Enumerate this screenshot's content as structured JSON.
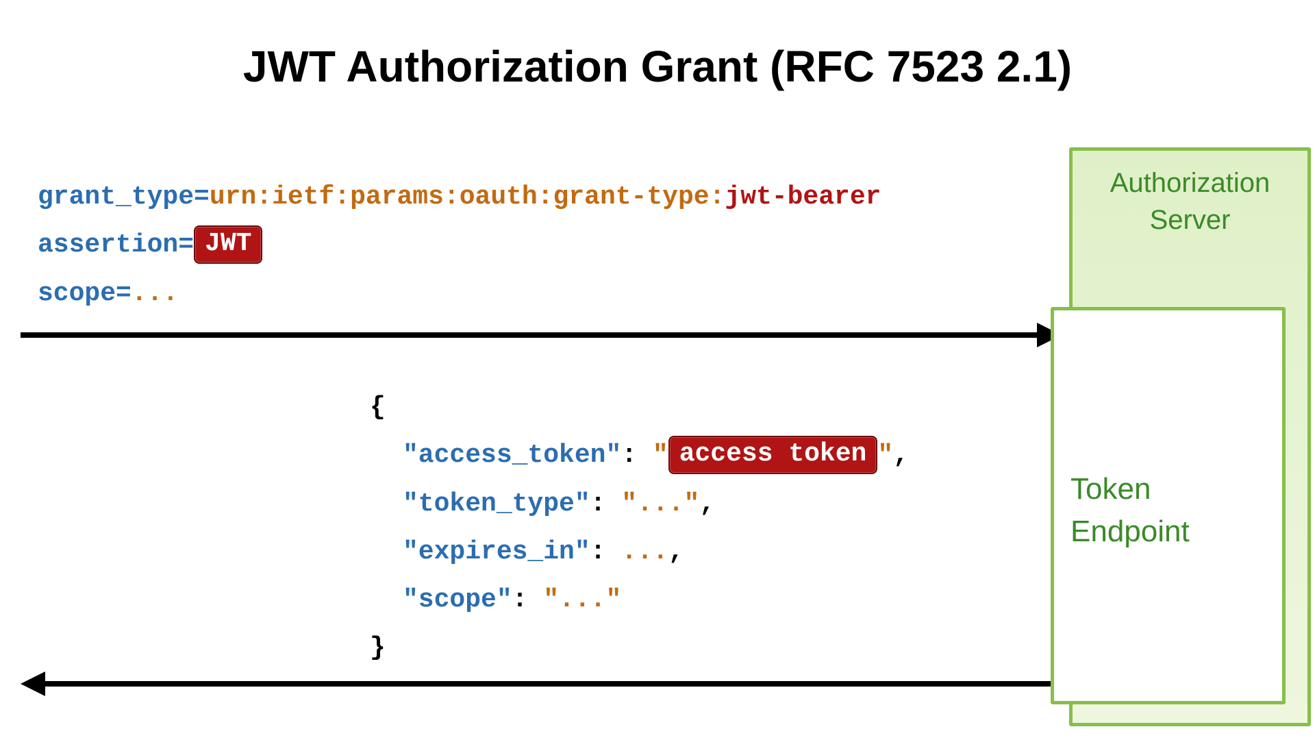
{
  "title": "JWT Authorization Grant (RFC 7523 2.1)",
  "request": {
    "grant_type_key": "grant_type",
    "grant_type_urn": "urn:ietf:params:oauth:grant-type:",
    "grant_type_suffix": "jwt-bearer",
    "assertion_key": "assertion",
    "assertion_chip": "JWT",
    "scope_key": "scope",
    "scope_value": "..."
  },
  "response": {
    "access_token_key": "\"access_token\"",
    "access_token_chip": "access token",
    "token_type_key": "\"token_type\"",
    "token_type_val": "\"...\"",
    "expires_in_key": "\"expires_in\"",
    "expires_in_val": "...",
    "scope_key": "\"scope\"",
    "scope_val": "\"...\""
  },
  "boxes": {
    "auth_server": "Authorization\nServer",
    "token_endpoint": "Token\nEndpoint"
  },
  "punct": {
    "eq": "=",
    "colon_space": ": ",
    "comma": ",",
    "open_brace": "{",
    "close_brace": "}",
    "quote": "\""
  }
}
